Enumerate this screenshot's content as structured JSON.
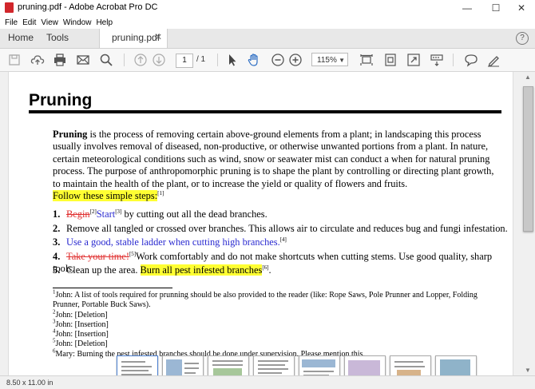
{
  "window": {
    "title": "pruning.pdf - Adobe Acrobat Pro DC"
  },
  "menu": [
    "File",
    "Edit",
    "View",
    "Window",
    "Help"
  ],
  "tabs": {
    "home": "Home",
    "tools": "Tools",
    "doc": "pruning.pdf"
  },
  "toolbar": {
    "page_current": "1",
    "page_total": "/ 1",
    "zoom": "115%"
  },
  "document": {
    "heading": "Pruning",
    "intro_bold": "Pruning",
    "intro_rest": " is the process of removing certain above-ground elements from a plant; in landscaping this process usually involves removal of diseased, non-productive, or otherwise unwanted portions from a plant. In nature, certain meteorological conditions such as wind, snow or seawater mist can conduct a when for natural pruning process. The purpose of anthropomorphic pruning is to shape the plant by controlling or directing plant growth, to maintain the health of the plant, or to increase the yield or quality of flowers and fruits.",
    "steps_intro": "Follow these simple steps:",
    "steps_intro_ref": "[1]",
    "steps": [
      {
        "num": "1.",
        "del": "Begin",
        "ref1": "[2]",
        "ins": "Start",
        "ref2": "[3]",
        "text": " by cutting out all the dead branches."
      },
      {
        "num": "2.",
        "text": "Remove all tangled or crossed over branches. This allows air to circulate and reduces bug and fungi infestation."
      },
      {
        "num": "3.",
        "ins": "Use a good, stable ladder when cutting high branches.",
        "ref": "[4]"
      },
      {
        "num": "4.",
        "del": "Take your time!",
        "ref": "[5]",
        "text": "Work comfortably and do not make shortcuts when cutting stems. Use good quality, sharp tools."
      },
      {
        "num": "5.",
        "text": "Clean up the area. ",
        "hl": "Burn all pest infested branches",
        "ref": "[6]",
        "end": "."
      }
    ],
    "footnotes": [
      {
        "n": "1",
        "text": "John:  A list of tools required for prunning should be also provided to the reader (like: Rope Saws, Pole Prunner and Lopper, Folding Prunner, Portable Buck Saws)."
      },
      {
        "n": "2",
        "text": "John:  [Deletion]"
      },
      {
        "n": "3",
        "text": "John:  [Insertion]"
      },
      {
        "n": "4",
        "text": "John:  [Insertion]"
      },
      {
        "n": "5",
        "text": "John:  [Deletion]"
      },
      {
        "n": "6",
        "text": "Mary:  Burning the pest infested branches should be done under supervision. Please mention this."
      }
    ]
  },
  "status": {
    "page_size": "8.50 x 11.00 in"
  },
  "colors": {
    "highlight": "#ffff33",
    "deletion": "#e03030",
    "insertion": "#2a2ad0",
    "acrobat_red": "#d1262b"
  }
}
